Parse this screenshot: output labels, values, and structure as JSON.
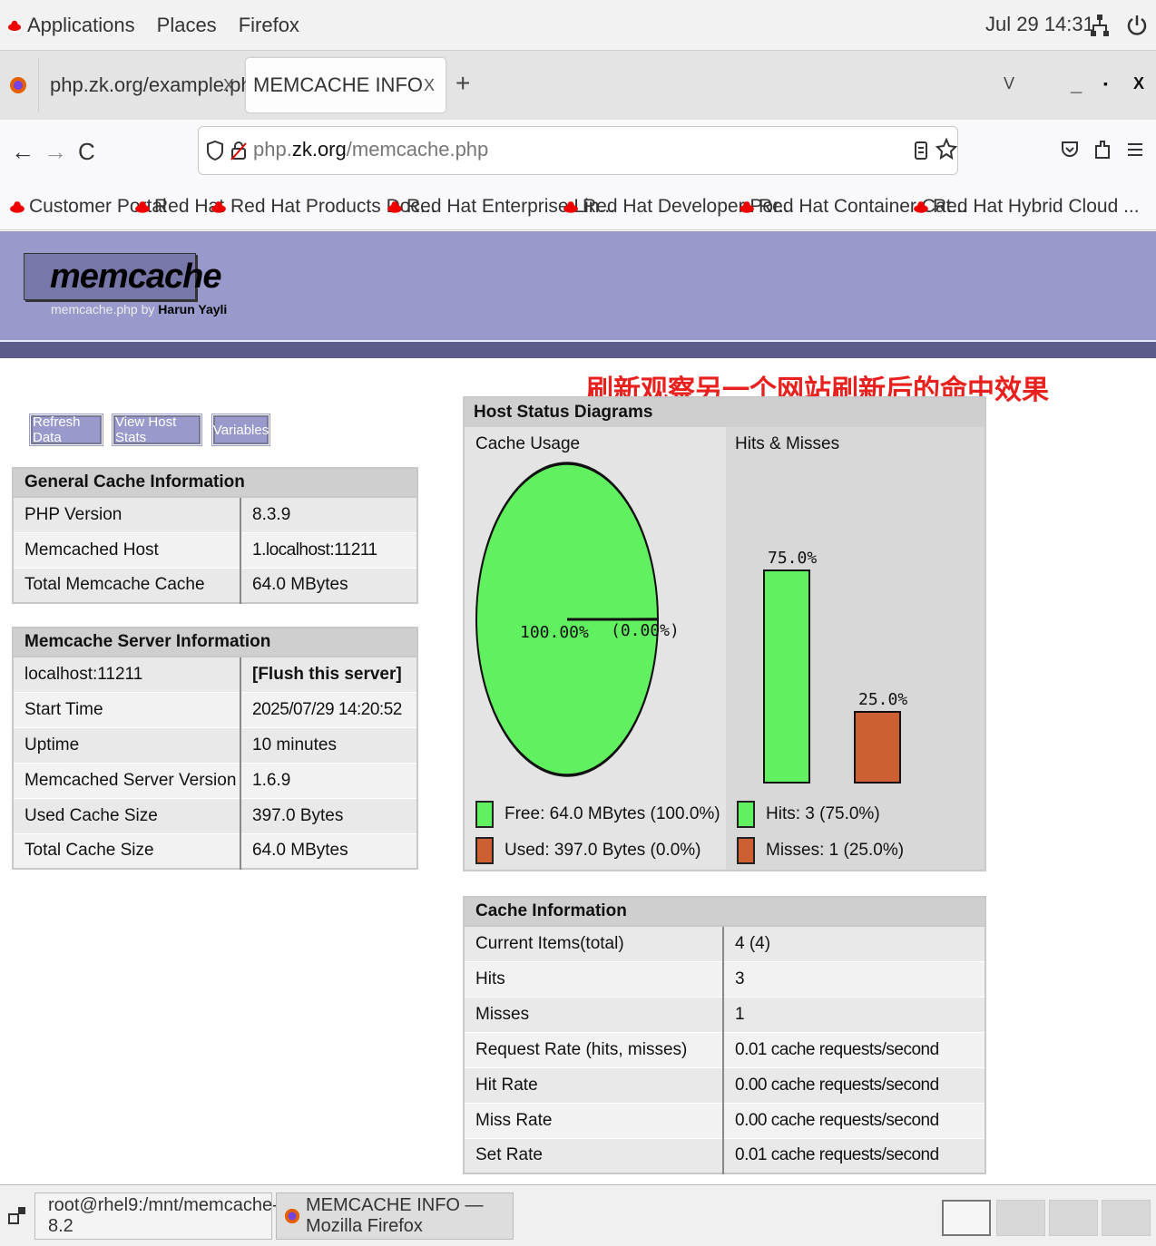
{
  "topbar": {
    "applications": "Applications",
    "places": "Places",
    "firefox": "Firefox",
    "clock": "Jul 29 14:31"
  },
  "tabs": [
    {
      "label": "php.zk.org/example.php",
      "close": "X"
    },
    {
      "label": "MEMCACHE INFO",
      "close": "X"
    }
  ],
  "tabbar": {
    "new_tab": "+",
    "list": "V",
    "min": "_",
    "max": "▪",
    "close": "X"
  },
  "nav": {
    "back": "←",
    "forward": "→",
    "reload": "C",
    "url_prefix": "php.",
    "url_domain": "zk.org",
    "url_path": "/memcache.php"
  },
  "bookmarks": [
    "Customer Portal",
    "Red Hat",
    "Red Hat Products Doc...",
    "Red Hat Enterprise Lin...",
    "Red Hat Developer Por...",
    "Red Hat Container Cat...",
    "Red Hat Hybrid Cloud ..."
  ],
  "header": {
    "logo": "memcache",
    "sub_prefix": "memcache.php by ",
    "sub_author": "Harun Yayli"
  },
  "annotation": "刷新观察另一个网站刷新后的命中效果",
  "buttons": [
    "Refresh Data",
    "View Host Stats",
    "Variables"
  ],
  "general": {
    "title": "General Cache Information",
    "rows": [
      [
        "PHP Version",
        "8.3.9"
      ],
      [
        "Memcached Host",
        "1.localhost:11211"
      ],
      [
        "Total Memcache Cache",
        "64.0 MBytes"
      ]
    ]
  },
  "server": {
    "title": "Memcache Server Information",
    "host": "localhost:11211",
    "flush": "[Flush this server]",
    "rows": [
      [
        "Start Time",
        "2025/07/29 14:20:52"
      ],
      [
        "Uptime",
        "10 minutes"
      ],
      [
        "Memcached Server Version",
        "1.6.9"
      ],
      [
        "Used Cache Size",
        "397.0 Bytes"
      ],
      [
        "Total Cache Size",
        "64.0 MBytes"
      ]
    ]
  },
  "diagrams": {
    "title": "Host Status Diagrams",
    "cache_usage": "Cache Usage",
    "hits_misses": "Hits & Misses",
    "pie_free_label": "100.00%",
    "pie_used_label": "(0.00%)",
    "hits_pct": "75.0%",
    "misses_pct": "25.0%",
    "legend_free": "Free: 64.0 MBytes (100.0%)",
    "legend_used": "Used: 397.0 Bytes (0.0%)",
    "legend_hits": "Hits: 3 (75.0%)",
    "legend_misses": "Misses: 1 (25.0%)"
  },
  "chart_data": [
    {
      "type": "pie",
      "categories": [
        "Free",
        "Used"
      ],
      "values": [
        100.0,
        0.0
      ],
      "title": "Cache Usage"
    },
    {
      "type": "bar",
      "categories": [
        "Hits",
        "Misses"
      ],
      "values": [
        75.0,
        25.0
      ],
      "title": "Hits & Misses"
    }
  ],
  "colors": {
    "green": "#60f060",
    "orange": "#cc6033",
    "header": "#9999cc"
  },
  "cacheinfo": {
    "title": "Cache Information",
    "rows": [
      [
        "Current Items(total)",
        "4 (4)"
      ],
      [
        "Hits",
        "3"
      ],
      [
        "Misses",
        "1"
      ],
      [
        "Request Rate (hits, misses)",
        "0.01 cache requests/second"
      ],
      [
        "Hit Rate",
        "0.00 cache requests/second"
      ],
      [
        "Miss Rate",
        "0.00 cache requests/second"
      ],
      [
        "Set Rate",
        "0.01 cache requests/second"
      ]
    ]
  },
  "taskbar": {
    "terminal": "root@rhel9:/mnt/memcache-8.2",
    "firefox": "MEMCACHE INFO — Mozilla Firefox"
  }
}
